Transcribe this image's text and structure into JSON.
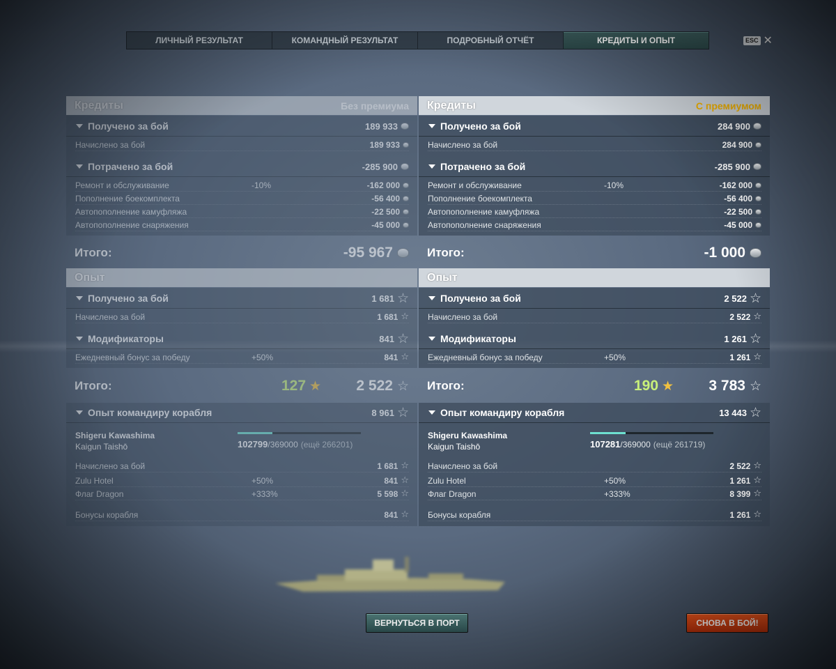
{
  "tabs": [
    {
      "label": "ЛИЧНЫЙ РЕЗУЛЬТАТ",
      "active": false
    },
    {
      "label": "КОМАНДНЫЙ РЕЗУЛЬТАТ",
      "active": false
    },
    {
      "label": "ПОДРОБНЫЙ ОТЧЁТ",
      "active": false
    },
    {
      "label": "КРЕДИТЫ И ОПЫТ",
      "active": true
    }
  ],
  "esc_label": "ESC",
  "close_glyph": "✕",
  "left": {
    "credits_title": "Кредиты",
    "mode": "Без премиума",
    "earned": {
      "label": "Получено за бой",
      "value": "189 933",
      "rows": [
        {
          "label": "Начислено за бой",
          "pct": "",
          "value": "189 933"
        }
      ]
    },
    "spent": {
      "label": "Потрачено за бой",
      "value": "-285 900",
      "rows": [
        {
          "label": "Ремонт и обслуживание",
          "pct": "-10%",
          "value": "-162 000"
        },
        {
          "label": "Пополнение боекомплекта",
          "pct": "",
          "value": "-56 400"
        },
        {
          "label": "Автопополнение камуфляжа",
          "pct": "",
          "value": "-22 500"
        },
        {
          "label": "Автопополнение снаряжения",
          "pct": "",
          "value": "-45 000"
        }
      ]
    },
    "total_label": "Итого:",
    "total_value": "-95 967",
    "exp_title": "Опыт",
    "exp_earned": {
      "label": "Получено за бой",
      "value": "1 681",
      "rows": [
        {
          "label": "Начислено за бой",
          "pct": "",
          "value": "1 681"
        }
      ]
    },
    "modifiers": {
      "label": "Модификаторы",
      "value": "841",
      "rows": [
        {
          "label": "Ежедневный бонус за победу",
          "pct": "+50%",
          "value": "841"
        }
      ]
    },
    "exp_total_label": "Итого:",
    "exp_bonus": "127",
    "exp_total": "2 522",
    "commander": {
      "label": "Опыт командиру корабля",
      "value": "8 961",
      "name": "Shigeru Kawashima",
      "rank": "Kaigun Taishō",
      "xp_current": "102799",
      "xp_max": "/369000",
      "xp_remaining": "(ещё 266201)",
      "progress": 0.28,
      "rows": [
        {
          "label": "Начислено за бой",
          "pct": "",
          "value": "1 681"
        },
        {
          "label": "Zulu Hotel",
          "pct": "+50%",
          "value": "841"
        },
        {
          "label": "Флаг Dragon",
          "pct": "+333%",
          "value": "5 598"
        },
        {
          "label": "Бонусы корабля",
          "pct": "",
          "value": "841"
        }
      ]
    }
  },
  "right": {
    "credits_title": "Кредиты",
    "mode": "С премиумом",
    "earned": {
      "label": "Получено за бой",
      "value": "284 900",
      "rows": [
        {
          "label": "Начислено за бой",
          "pct": "",
          "value": "284 900"
        }
      ]
    },
    "spent": {
      "label": "Потрачено за бой",
      "value": "-285 900",
      "rows": [
        {
          "label": "Ремонт и обслуживание",
          "pct": "-10%",
          "value": "-162 000"
        },
        {
          "label": "Пополнение боекомплекта",
          "pct": "",
          "value": "-56 400"
        },
        {
          "label": "Автопополнение камуфляжа",
          "pct": "",
          "value": "-22 500"
        },
        {
          "label": "Автопополнение снаряжения",
          "pct": "",
          "value": "-45 000"
        }
      ]
    },
    "total_label": "Итого:",
    "total_value": "-1 000",
    "exp_title": "Опыт",
    "exp_earned": {
      "label": "Получено за бой",
      "value": "2 522",
      "rows": [
        {
          "label": "Начислено за бой",
          "pct": "",
          "value": "2 522"
        }
      ]
    },
    "modifiers": {
      "label": "Модификаторы",
      "value": "1 261",
      "rows": [
        {
          "label": "Ежедневный бонус за победу",
          "pct": "+50%",
          "value": "1 261"
        }
      ]
    },
    "exp_total_label": "Итого:",
    "exp_bonus": "190",
    "exp_total": "3 783",
    "commander": {
      "label": "Опыт командиру корабля",
      "value": "13 443",
      "name": "Shigeru Kawashima",
      "rank": "Kaigun Taishō",
      "xp_current": "107281",
      "xp_max": "/369000",
      "xp_remaining": "(ещё 261719)",
      "progress": 0.29,
      "rows": [
        {
          "label": "Начислено за бой",
          "pct": "",
          "value": "2 522"
        },
        {
          "label": "Zulu Hotel",
          "pct": "+50%",
          "value": "1 261"
        },
        {
          "label": "Флаг Dragon",
          "pct": "+333%",
          "value": "8 399"
        },
        {
          "label": "Бонусы корабля",
          "pct": "",
          "value": "1 261"
        }
      ]
    }
  },
  "buttons": {
    "port": "ВЕРНУТЬСЯ В ПОРТ",
    "battle": "СНОВА В БОЙ!"
  },
  "colors": {
    "premium": "#f5b400",
    "bonus_xp": "#c8f07a",
    "battle_button": "#d8420f",
    "port_button": "#3e6464"
  }
}
